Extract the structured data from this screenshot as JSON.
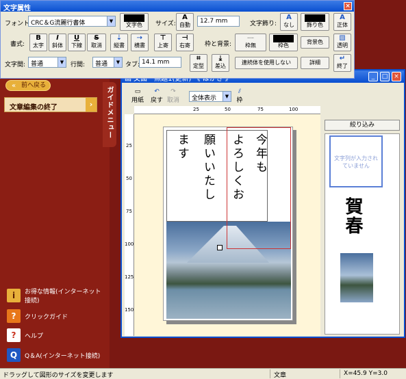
{
  "attr_panel": {
    "title": "文字属性",
    "labels": {
      "font": "フォント:",
      "size": "サイズ:",
      "spacing": "文字飾り:",
      "style": "書式:",
      "frame": "枠と背景:",
      "char_spacing": "文字間:",
      "line_spacing": "行間:",
      "tab": "タブ:"
    },
    "font_value": "CRC＆G流麗行書体",
    "size_value": "12.7 mm",
    "char_spacing_value": "普通",
    "line_spacing_value": "普通",
    "tab_value": "14.1 mm",
    "buttons": {
      "text_color": "文字色",
      "auto": "自動",
      "none": "なし",
      "border_color": "飾り色",
      "upright": "正体",
      "bold": "太字",
      "italic": "斜体",
      "underline": "下線",
      "cancel": "取消",
      "vertical": "縦書",
      "horizontal": "横書",
      "top": "上寄",
      "right": "右寄",
      "no_frame": "枠無",
      "frame_color": "枠色",
      "bg_color": "背景色",
      "transparent": "透明",
      "fixed": "定型",
      "insert": "差込",
      "link_box": "連続体を使用しない",
      "detail": "詳細",
      "finish": "終了"
    }
  },
  "sidebar": {
    "back": "前へ戻る",
    "end_edit": "文章編集の終了",
    "guide_tab": "ガイドメニュー",
    "links": [
      {
        "icon": "i",
        "label": "お得な情報(インターネット接続)"
      },
      {
        "icon": "?",
        "label": "クリックガイド"
      },
      {
        "icon": "?",
        "label": "ヘルプ"
      },
      {
        "icon": "Q",
        "label": "Q＆A(インターネット接続)"
      }
    ]
  },
  "doc_window": {
    "title": "画 文面　無題1(更新) 《 はがき 》",
    "toolbar": {
      "paper": "用紙",
      "undo": "戻す",
      "redo": "取消",
      "zoom": "全体表示",
      "frame": "枠"
    },
    "ruler_top": [
      "25",
      "50",
      "75",
      "100"
    ],
    "ruler_left": [
      "25",
      "50",
      "75",
      "100",
      "125",
      "150"
    ],
    "card_lines": [
      "今年も",
      "よろしくお",
      "願いいたし",
      "ます"
    ],
    "filter": "絞り込み",
    "thumb_placeholder": "文字列が入力されていません",
    "thumb_greeting": "賀春"
  },
  "status": {
    "message": "ドラッグして図形のサイズを変更します",
    "mode": "文章",
    "coords": "X=45.9 Y=3.0"
  },
  "colors": {
    "sidebar": "#8b1e14",
    "accent": "#e8b03a",
    "titlebar": "#0a4fd0"
  }
}
